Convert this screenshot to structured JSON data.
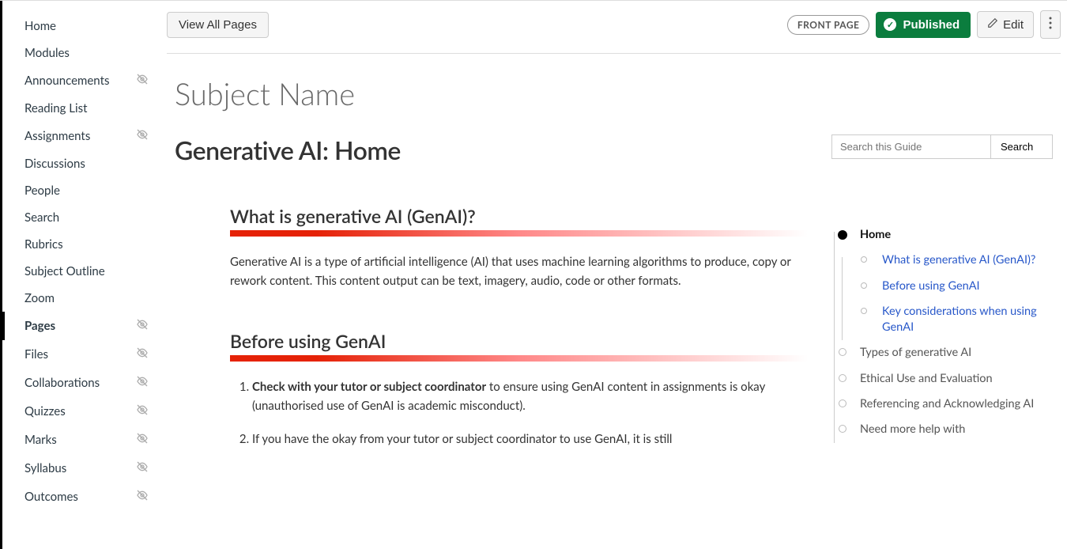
{
  "sidebar": {
    "items": [
      {
        "label": "Home",
        "hidden": false,
        "active": false
      },
      {
        "label": "Modules",
        "hidden": false,
        "active": false
      },
      {
        "label": "Announcements",
        "hidden": true,
        "active": false
      },
      {
        "label": "Reading List",
        "hidden": false,
        "active": false
      },
      {
        "label": "Assignments",
        "hidden": true,
        "active": false
      },
      {
        "label": "Discussions",
        "hidden": false,
        "active": false
      },
      {
        "label": "People",
        "hidden": false,
        "active": false
      },
      {
        "label": "Search",
        "hidden": false,
        "active": false
      },
      {
        "label": "Rubrics",
        "hidden": false,
        "active": false
      },
      {
        "label": "Subject Outline",
        "hidden": false,
        "active": false
      },
      {
        "label": "Zoom",
        "hidden": false,
        "active": false
      },
      {
        "label": "Pages",
        "hidden": true,
        "active": true
      },
      {
        "label": "Files",
        "hidden": true,
        "active": false
      },
      {
        "label": "Collaborations",
        "hidden": true,
        "active": false
      },
      {
        "label": "Quizzes",
        "hidden": true,
        "active": false
      },
      {
        "label": "Marks",
        "hidden": true,
        "active": false
      },
      {
        "label": "Syllabus",
        "hidden": true,
        "active": false
      },
      {
        "label": "Outcomes",
        "hidden": true,
        "active": false
      }
    ]
  },
  "topbar": {
    "view_all_label": "View All Pages",
    "front_page_label": "FRONT PAGE",
    "published_label": "Published",
    "edit_label": "Edit"
  },
  "page": {
    "title": "Subject Name"
  },
  "guide": {
    "title": "Generative AI: Home",
    "search_placeholder": "Search this Guide",
    "search_button": "Search"
  },
  "sections": [
    {
      "heading": "What is generative AI (GenAI)?",
      "body": "Generative AI is a type of artificial intelligence (AI) that uses machine learning algorithms to produce, copy or rework content. This content output can be text, imagery, audio, code or other formats."
    },
    {
      "heading": "Before using GenAI",
      "list": [
        {
          "bold": "Check with your tutor or subject coordinator",
          "rest": " to ensure using GenAI content in assignments is okay (unauthorised use of GenAI is academic misconduct)."
        },
        {
          "bold": "",
          "rest": "If you have the okay from your tutor or subject coordinator to use GenAI, it is still"
        }
      ]
    }
  ],
  "toc": {
    "items": [
      {
        "label": "Home",
        "current": true,
        "children": [
          {
            "label": "What is generative AI (GenAI)?"
          },
          {
            "label": "Before using GenAI"
          },
          {
            "label": "Key considerations when using GenAI"
          }
        ]
      },
      {
        "label": "Types of generative AI",
        "current": false
      },
      {
        "label": "Ethical Use and Evaluation",
        "current": false
      },
      {
        "label": "Referencing and Acknowledging AI",
        "current": false
      },
      {
        "label": "Need more help with",
        "current": false
      }
    ]
  }
}
